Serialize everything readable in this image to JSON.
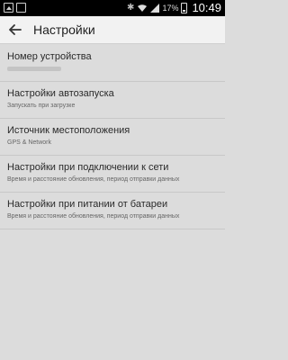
{
  "status_bar": {
    "icons": [
      "image-notification-icon",
      "bluetooth-icon",
      "wifi-icon",
      "signal-icon",
      "battery-icon"
    ],
    "battery_percent": "17%",
    "time": "10:49"
  },
  "app_bar": {
    "back_icon": "arrow-left-icon",
    "title": "Настройки"
  },
  "settings": [
    {
      "title": "Номер устройства",
      "subtitle": ""
    },
    {
      "title": "Настройки автозапуска",
      "subtitle": "Запускать при загрузке"
    },
    {
      "title": "Источник местоположения",
      "subtitle": "GPS  & Network"
    },
    {
      "title": "Настройки при подключении к сети",
      "subtitle": "Время и расстояние обновления, период отправки данных"
    },
    {
      "title": "Настройки при питании от батареи",
      "subtitle": "Время и расстояние обновления, период отправки данных"
    }
  ],
  "colors": {
    "status_bar": "#000000",
    "app_bar": "#f2f2f2",
    "background": "#dcdcdc",
    "divider": "#c8c8c8"
  }
}
